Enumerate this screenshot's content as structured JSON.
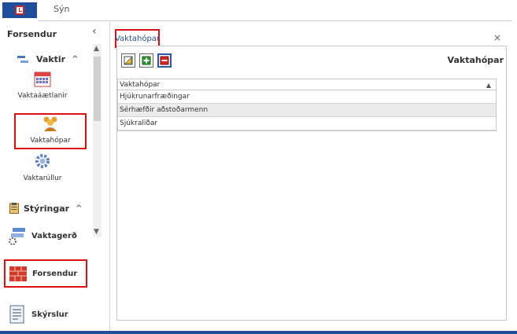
{
  "ribbon": {
    "tab_view": "Sýn"
  },
  "left_panel": {
    "header": "Forsendur",
    "groups": {
      "vaktir": "Vaktir",
      "styringar": "Stýringar"
    },
    "vaktir_items": [
      "Vaktaáætlanir",
      "Vaktahópar",
      "Vaktarúllur"
    ],
    "bottom_nav": [
      "Vaktagerð",
      "Forsendur",
      "Skýrslur"
    ]
  },
  "main": {
    "tab_label": "Vaktahópar",
    "panel_title": "Vaktahópar",
    "grid": {
      "column": "Vaktahópar",
      "rows": [
        "Hjúkrunarfræðingar",
        "Sérhæfðir aðstoðarmenn",
        "Sjúkraliðar"
      ]
    }
  },
  "icons": {
    "edit": "pencil-icon",
    "add": "plus-icon",
    "remove": "minus-icon"
  },
  "colors": {
    "accent": "#1f4f9c",
    "highlight": "#dd1111"
  }
}
